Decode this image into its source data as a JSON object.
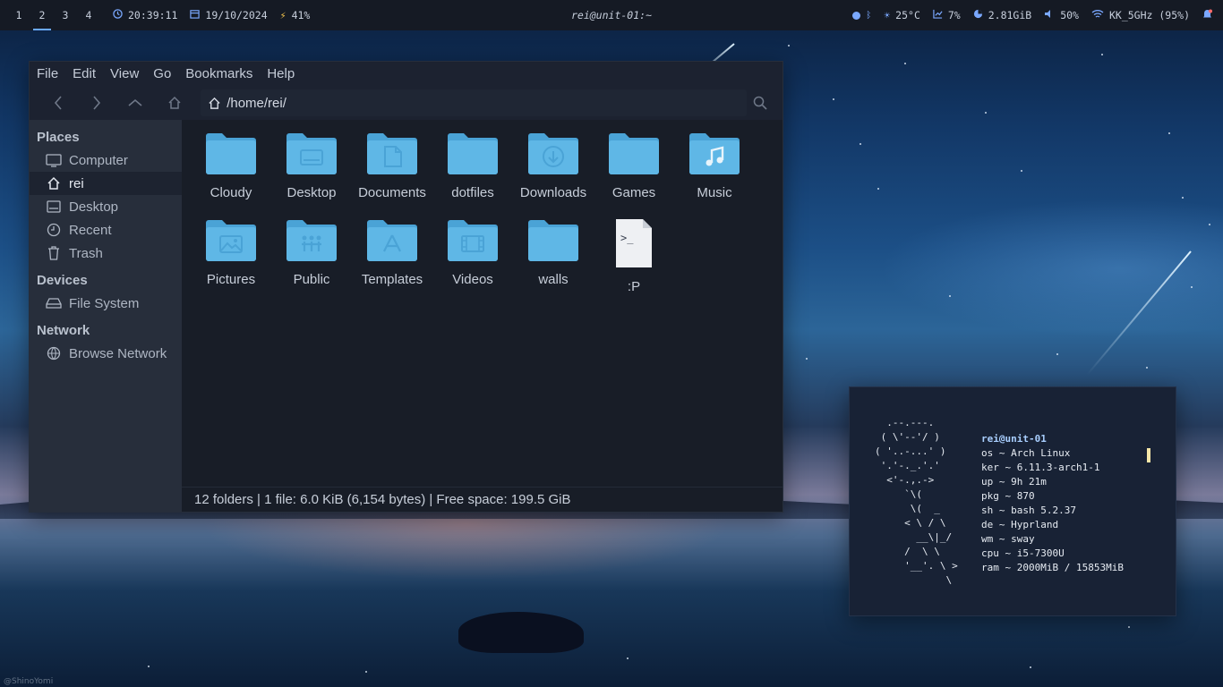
{
  "topbar": {
    "workspaces": [
      "1",
      "2",
      "3",
      "4"
    ],
    "active_workspace": "2",
    "time": "20:39:11",
    "date": "19/10/2024",
    "battery": "41%",
    "title": "rei@unit-01:~",
    "temperature": "25°C",
    "cpu": "7%",
    "memory": "2.81GiB",
    "volume": "50%",
    "wifi": "KK_5GHz (95%)"
  },
  "filemanager": {
    "menu": [
      "File",
      "Edit",
      "View",
      "Go",
      "Bookmarks",
      "Help"
    ],
    "location": "/home/rei/",
    "sidebar": {
      "places_heading": "Places",
      "places": [
        {
          "label": "Computer",
          "icon": "monitor-icon"
        },
        {
          "label": "rei",
          "icon": "home-icon"
        },
        {
          "label": "Desktop",
          "icon": "desktop-icon"
        },
        {
          "label": "Recent",
          "icon": "clock-icon"
        },
        {
          "label": "Trash",
          "icon": "trash-icon"
        }
      ],
      "devices_heading": "Devices",
      "devices": [
        {
          "label": "File System",
          "icon": "drive-icon"
        }
      ],
      "network_heading": "Network",
      "network": [
        {
          "label": "Browse Network",
          "icon": "network-icon"
        }
      ]
    },
    "items": [
      {
        "label": "Cloudy",
        "icon": "folder-icon"
      },
      {
        "label": "Desktop",
        "icon": "folder-desktop-icon"
      },
      {
        "label": "Documents",
        "icon": "folder-documents-icon"
      },
      {
        "label": "dotfiles",
        "icon": "folder-icon"
      },
      {
        "label": "Downloads",
        "icon": "folder-download-icon"
      },
      {
        "label": "Games",
        "icon": "folder-icon"
      },
      {
        "label": "Music",
        "icon": "folder-music-icon"
      },
      {
        "label": "Pictures",
        "icon": "folder-pictures-icon"
      },
      {
        "label": "Public",
        "icon": "folder-public-icon"
      },
      {
        "label": "Templates",
        "icon": "folder-templates-icon"
      },
      {
        "label": "Videos",
        "icon": "folder-videos-icon"
      },
      {
        "label": "walls",
        "icon": "folder-icon"
      },
      {
        "label": ":P",
        "icon": "terminal-script-icon"
      }
    ],
    "status": "12 folders  |  1 file: 6.0 KiB (6,154 bytes)  |  Free space: 199.5 GiB"
  },
  "terminal": {
    "ascii": "  .--.---.\n ( \\'--'/ )\n( '..-...' )\n '.'-._.'.'\n  <'-.,.->\n     `\\(\n      \\(  _\n     < \\ / \\\n       __\\|_/\n     /  \\ \\\n     '__'. \\ >\n            \\",
    "user": "rei@unit-01",
    "lines": [
      "os ~ Arch Linux",
      "ker ~ 6.11.3-arch1-1",
      "up ~ 9h 21m",
      "pkg ~ 870",
      "sh ~ bash 5.2.37",
      "de ~ Hyprland",
      "wm ~ sway",
      "cpu ~ i5-7300U",
      "ram ~ 2000MiB / 15853MiB"
    ]
  },
  "wallpaper": {
    "credit": "@ShinoYomi"
  },
  "colors": {
    "folder": "#5fb7e6",
    "folder_dark": "#4aa3d6",
    "accent": "#6aa9ff",
    "bar_bg": "#151a24"
  }
}
